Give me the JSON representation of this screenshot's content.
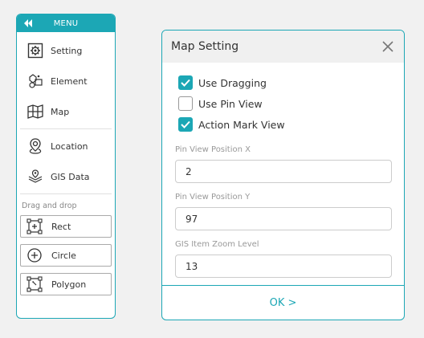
{
  "colors": {
    "accent": "#1ca7b5",
    "panel_bg": "#ffffff",
    "page_bg": "#f1f1f1"
  },
  "menu": {
    "title": "MENU",
    "collapse_icon": "double-chevron-left-icon",
    "items": [
      {
        "label": "Setting",
        "icon": "gear-icon"
      },
      {
        "label": "Element",
        "icon": "element-icon"
      },
      {
        "label": "Map",
        "icon": "map-icon"
      },
      {
        "label": "Location",
        "icon": "location-pin-icon"
      },
      {
        "label": "GIS Data",
        "icon": "layers-icon"
      }
    ],
    "drag_label": "Drag and drop",
    "shapes": [
      {
        "label": "Rect",
        "icon": "rect-icon"
      },
      {
        "label": "Circle",
        "icon": "circle-plus-icon"
      },
      {
        "label": "Polygon",
        "icon": "polygon-icon"
      }
    ]
  },
  "dialog": {
    "title": "Map Setting",
    "checkboxes": [
      {
        "label": "Use Dragging",
        "checked": true
      },
      {
        "label": "Use Pin View",
        "checked": false
      },
      {
        "label": "Action Mark View",
        "checked": true
      }
    ],
    "fields": [
      {
        "label": "Pin View Position X",
        "value": "2"
      },
      {
        "label": "Pin View Position Y",
        "value": "97"
      },
      {
        "label": "GIS Item Zoom Level",
        "value": "13"
      }
    ],
    "ok_label": "OK >"
  }
}
